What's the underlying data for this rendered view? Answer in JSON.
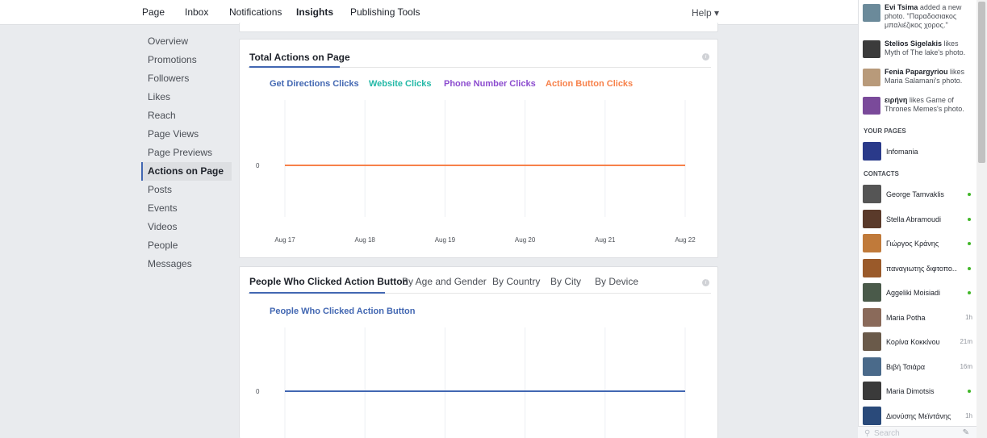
{
  "topnav": {
    "items": [
      "Page",
      "Inbox",
      "Notifications",
      "Insights",
      "Publishing Tools"
    ],
    "active": "Insights",
    "help": "Help ▾"
  },
  "sidebar": {
    "items": [
      "Overview",
      "Promotions",
      "Followers",
      "Likes",
      "Reach",
      "Page Views",
      "Page Previews",
      "Actions on Page",
      "Posts",
      "Events",
      "Videos",
      "People",
      "Messages"
    ],
    "active": "Actions on Page"
  },
  "card1": {
    "title": "Total Actions on Page",
    "legend": [
      {
        "label": "Get Directions Clicks",
        "color": "#4267b2"
      },
      {
        "label": "Website Clicks",
        "color": "#22b8a6"
      },
      {
        "label": "Phone Number Clicks",
        "color": "#8c4ccf"
      },
      {
        "label": "Action Button Clicks",
        "color": "#f7814a"
      }
    ]
  },
  "card2": {
    "tabs": [
      "People Who Clicked Action Button",
      "By Age and Gender",
      "By Country",
      "By City",
      "By Device"
    ],
    "active_tab": "People Who Clicked Action Button",
    "legend": {
      "label": "People Who Clicked Action Button",
      "color": "#4267b2"
    }
  },
  "chart_data": [
    {
      "type": "line",
      "x": [
        "Aug 17",
        "Aug 18",
        "Aug 19",
        "Aug 20",
        "Aug 21",
        "Aug 22"
      ],
      "series": [
        {
          "name": "Get Directions Clicks",
          "values": [
            0,
            0,
            0,
            0,
            0,
            0
          ]
        },
        {
          "name": "Website Clicks",
          "values": [
            0,
            0,
            0,
            0,
            0,
            0
          ]
        },
        {
          "name": "Phone Number Clicks",
          "values": [
            0,
            0,
            0,
            0,
            0,
            0
          ]
        },
        {
          "name": "Action Button Clicks",
          "values": [
            0,
            0,
            0,
            0,
            0,
            0
          ]
        }
      ],
      "yticks": [
        "0"
      ],
      "line_color": "#f7814a",
      "grid": true
    },
    {
      "type": "line",
      "x": [
        "Aug 17",
        "Aug 18",
        "Aug 19",
        "Aug 20",
        "Aug 21",
        "Aug 22"
      ],
      "series": [
        {
          "name": "People Who Clicked Action Button",
          "values": [
            0,
            0,
            0,
            0,
            0,
            0
          ]
        }
      ],
      "yticks": [
        "0"
      ],
      "line_color": "#4267b2",
      "grid": true
    }
  ],
  "notifications": [
    {
      "name": "Evi Tsima",
      "rest": " added a new photo. \"Παραδοσιακος μπαλιέζικος χορος.\"",
      "color": "#6b8a9a"
    },
    {
      "name": "Stelios Sigelakis",
      "rest": " likes Myth of The lake's photo.",
      "color": "#3b3b3b"
    },
    {
      "name": "Fenia Papargyriou",
      "rest": " likes Maria Salamani's photo.",
      "color": "#b89a7a"
    },
    {
      "name": "ειρήνη",
      "rest": " likes Game of Thrones Memes's photo.",
      "color": "#7a4a9a"
    }
  ],
  "your_pages": {
    "title": "YOUR PAGES",
    "items": [
      {
        "name": "Infomania",
        "color": "#2a3a8a"
      }
    ]
  },
  "contacts": {
    "title": "CONTACTS",
    "items": [
      {
        "name": "George Tamvaklis",
        "status": "online",
        "color": "#555"
      },
      {
        "name": "Stella Abramoudi",
        "status": "online",
        "color": "#5a3a2a"
      },
      {
        "name": "Γιώργος Κράνης",
        "status": "online",
        "color": "#c07a3a"
      },
      {
        "name": "παναγιωτης διφτοπο...",
        "status": "online",
        "color": "#9a5a2a"
      },
      {
        "name": "Aggeliki Moisiadi",
        "status": "online",
        "color": "#4a5a4a"
      },
      {
        "name": "Maria Potha",
        "status": "1h",
        "color": "#8a6a5a"
      },
      {
        "name": "Κορίνα Κοκκίνου",
        "status": "21m",
        "color": "#6a5a4a"
      },
      {
        "name": "Βιβή Τσιάρα",
        "status": "16m",
        "color": "#4a6a8a"
      },
      {
        "name": "Maria Dimotsis",
        "status": "online",
        "color": "#3a3a3a"
      },
      {
        "name": "Διονύσης Μεϊντάνης",
        "status": "1h",
        "color": "#2a4a7a"
      }
    ]
  },
  "search": {
    "placeholder": "Search"
  }
}
